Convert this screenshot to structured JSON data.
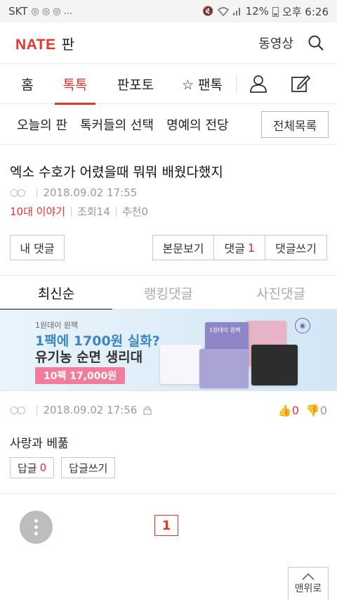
{
  "status_bar": {
    "carrier": "SKT",
    "notif_icons": "◎ ◎ ◎ ...",
    "battery": "12%",
    "time": "오후 6:26"
  },
  "header": {
    "logo_nate": "NATE",
    "logo_pan": "판",
    "video_link": "동영상"
  },
  "main_nav": {
    "tabs": [
      {
        "label": "홈"
      },
      {
        "label": "톡톡"
      },
      {
        "label": "판포토"
      },
      {
        "label": "☆ 팬톡"
      }
    ],
    "active_tab": "톡톡"
  },
  "sub_nav": {
    "items": [
      "오늘의 판",
      "톡커들의 선택",
      "명예의 전당"
    ],
    "all_list": "전체목록"
  },
  "post": {
    "title": "엑소 수호가 어렸을때 뭐뭐 배웠다했지",
    "author": "○○",
    "datetime": "2018.09.02 17:55",
    "category": "10대 이야기",
    "views": "조회14",
    "recommends": "추천0"
  },
  "actions": {
    "my_comment": "내 댓글",
    "view_body": "본문보기",
    "comment_label": "댓글",
    "comment_count": "1",
    "write_comment": "댓글쓰기"
  },
  "comment_tabs": [
    {
      "label": "최신순"
    },
    {
      "label": "랭킹댓글"
    },
    {
      "label": "사진댓글"
    }
  ],
  "ad": {
    "brand": "1원데이 원팩",
    "headline": "1팩에 1700원 실화?",
    "headline2": "유기농 순면 생리대",
    "price": "10팩 17,000원",
    "package_text": "1원데이 원팩"
  },
  "comment": {
    "author": "○○",
    "datetime": "2018.09.02 17:56",
    "upvotes": "0",
    "downvotes": "0",
    "body": "사랑과 베풂",
    "reply_label": "답글",
    "reply_count": "0",
    "write_reply": "답글쓰기"
  },
  "pagination": {
    "current_page": "1"
  },
  "top_button": "맨위로",
  "colors": {
    "brand_red": "#e8322a",
    "ad_blue": "#3a86c6",
    "ad_pink": "#f37b9c"
  }
}
